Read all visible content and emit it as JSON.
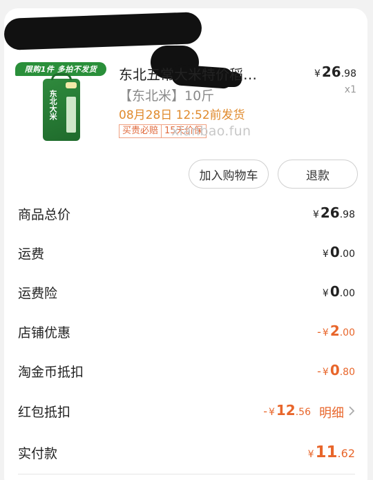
{
  "product": {
    "promo_banner": "限购1件 多拍不发货",
    "bag_text": "东北大米",
    "title": "东北五常大米特价稻…",
    "spec": "【东北米】10斤",
    "ship_time": "08月28日 12:52前发货",
    "tags": [
      "买贵必赔",
      "15天价保"
    ],
    "watermark": "xianbao.fun",
    "price": {
      "currency": "¥",
      "int": "26",
      "dec": ".98"
    },
    "qty": "x1"
  },
  "actions": {
    "add_to_cart": "加入购物车",
    "refund": "退款"
  },
  "summary": {
    "subtotal": {
      "label": "商品总价",
      "currency": "¥",
      "int": "26",
      "dec": ".98"
    },
    "shipping": {
      "label": "运费",
      "currency": "¥",
      "int": "0",
      "dec": ".00"
    },
    "shipping_insurance": {
      "label": "运费险",
      "currency": "¥",
      "int": "0",
      "dec": ".00"
    },
    "store_discount": {
      "label": "店铺优惠",
      "minus": "-",
      "currency": "¥",
      "int": "2",
      "dec": ".00"
    },
    "taojinbi": {
      "label": "淘金币抵扣",
      "minus": "-",
      "currency": "¥",
      "int": "0",
      "dec": ".80"
    },
    "red_packet": {
      "label": "红包抵扣",
      "minus": "-",
      "currency": "¥",
      "int": "12",
      "dec": ".56",
      "detail_label": "明细"
    },
    "paid": {
      "label": "实付款",
      "currency": "¥",
      "int": "11",
      "dec": ".62"
    }
  },
  "colors": {
    "accent": "#e8662b",
    "ship_time": "#e08a2c",
    "promo_green": "#2a8f3a"
  },
  "icons": {
    "chevron": "chevron-right-icon"
  }
}
